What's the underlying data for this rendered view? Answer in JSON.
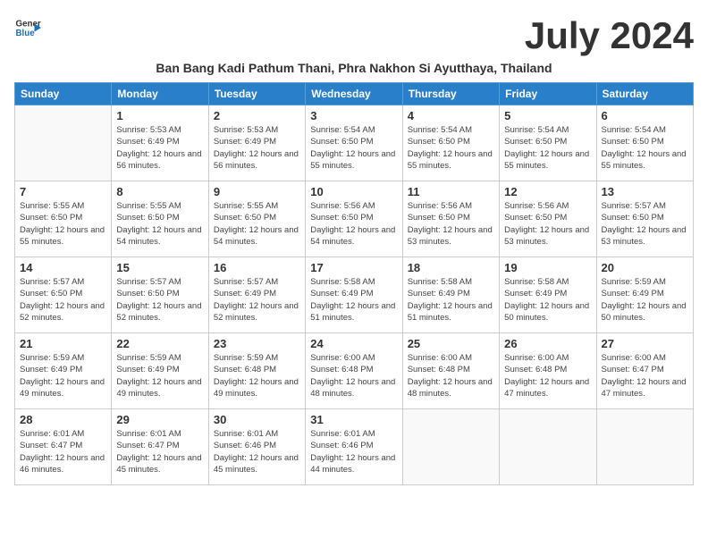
{
  "logo": {
    "text_general": "General",
    "text_blue": "Blue",
    "icon": "▶"
  },
  "month_title": "July 2024",
  "subtitle": "Ban Bang Kadi Pathum Thani, Phra Nakhon Si Ayutthaya, Thailand",
  "headers": [
    "Sunday",
    "Monday",
    "Tuesday",
    "Wednesday",
    "Thursday",
    "Friday",
    "Saturday"
  ],
  "weeks": [
    [
      {
        "day": "",
        "sunrise": "",
        "sunset": "",
        "daylight": ""
      },
      {
        "day": "1",
        "sunrise": "Sunrise: 5:53 AM",
        "sunset": "Sunset: 6:49 PM",
        "daylight": "Daylight: 12 hours and 56 minutes."
      },
      {
        "day": "2",
        "sunrise": "Sunrise: 5:53 AM",
        "sunset": "Sunset: 6:49 PM",
        "daylight": "Daylight: 12 hours and 56 minutes."
      },
      {
        "day": "3",
        "sunrise": "Sunrise: 5:54 AM",
        "sunset": "Sunset: 6:50 PM",
        "daylight": "Daylight: 12 hours and 55 minutes."
      },
      {
        "day": "4",
        "sunrise": "Sunrise: 5:54 AM",
        "sunset": "Sunset: 6:50 PM",
        "daylight": "Daylight: 12 hours and 55 minutes."
      },
      {
        "day": "5",
        "sunrise": "Sunrise: 5:54 AM",
        "sunset": "Sunset: 6:50 PM",
        "daylight": "Daylight: 12 hours and 55 minutes."
      },
      {
        "day": "6",
        "sunrise": "Sunrise: 5:54 AM",
        "sunset": "Sunset: 6:50 PM",
        "daylight": "Daylight: 12 hours and 55 minutes."
      }
    ],
    [
      {
        "day": "7",
        "sunrise": "Sunrise: 5:55 AM",
        "sunset": "Sunset: 6:50 PM",
        "daylight": "Daylight: 12 hours and 55 minutes."
      },
      {
        "day": "8",
        "sunrise": "Sunrise: 5:55 AM",
        "sunset": "Sunset: 6:50 PM",
        "daylight": "Daylight: 12 hours and 54 minutes."
      },
      {
        "day": "9",
        "sunrise": "Sunrise: 5:55 AM",
        "sunset": "Sunset: 6:50 PM",
        "daylight": "Daylight: 12 hours and 54 minutes."
      },
      {
        "day": "10",
        "sunrise": "Sunrise: 5:56 AM",
        "sunset": "Sunset: 6:50 PM",
        "daylight": "Daylight: 12 hours and 54 minutes."
      },
      {
        "day": "11",
        "sunrise": "Sunrise: 5:56 AM",
        "sunset": "Sunset: 6:50 PM",
        "daylight": "Daylight: 12 hours and 53 minutes."
      },
      {
        "day": "12",
        "sunrise": "Sunrise: 5:56 AM",
        "sunset": "Sunset: 6:50 PM",
        "daylight": "Daylight: 12 hours and 53 minutes."
      },
      {
        "day": "13",
        "sunrise": "Sunrise: 5:57 AM",
        "sunset": "Sunset: 6:50 PM",
        "daylight": "Daylight: 12 hours and 53 minutes."
      }
    ],
    [
      {
        "day": "14",
        "sunrise": "Sunrise: 5:57 AM",
        "sunset": "Sunset: 6:50 PM",
        "daylight": "Daylight: 12 hours and 52 minutes."
      },
      {
        "day": "15",
        "sunrise": "Sunrise: 5:57 AM",
        "sunset": "Sunset: 6:50 PM",
        "daylight": "Daylight: 12 hours and 52 minutes."
      },
      {
        "day": "16",
        "sunrise": "Sunrise: 5:57 AM",
        "sunset": "Sunset: 6:49 PM",
        "daylight": "Daylight: 12 hours and 52 minutes."
      },
      {
        "day": "17",
        "sunrise": "Sunrise: 5:58 AM",
        "sunset": "Sunset: 6:49 PM",
        "daylight": "Daylight: 12 hours and 51 minutes."
      },
      {
        "day": "18",
        "sunrise": "Sunrise: 5:58 AM",
        "sunset": "Sunset: 6:49 PM",
        "daylight": "Daylight: 12 hours and 51 minutes."
      },
      {
        "day": "19",
        "sunrise": "Sunrise: 5:58 AM",
        "sunset": "Sunset: 6:49 PM",
        "daylight": "Daylight: 12 hours and 50 minutes."
      },
      {
        "day": "20",
        "sunrise": "Sunrise: 5:59 AM",
        "sunset": "Sunset: 6:49 PM",
        "daylight": "Daylight: 12 hours and 50 minutes."
      }
    ],
    [
      {
        "day": "21",
        "sunrise": "Sunrise: 5:59 AM",
        "sunset": "Sunset: 6:49 PM",
        "daylight": "Daylight: 12 hours and 49 minutes."
      },
      {
        "day": "22",
        "sunrise": "Sunrise: 5:59 AM",
        "sunset": "Sunset: 6:49 PM",
        "daylight": "Daylight: 12 hours and 49 minutes."
      },
      {
        "day": "23",
        "sunrise": "Sunrise: 5:59 AM",
        "sunset": "Sunset: 6:48 PM",
        "daylight": "Daylight: 12 hours and 49 minutes."
      },
      {
        "day": "24",
        "sunrise": "Sunrise: 6:00 AM",
        "sunset": "Sunset: 6:48 PM",
        "daylight": "Daylight: 12 hours and 48 minutes."
      },
      {
        "day": "25",
        "sunrise": "Sunrise: 6:00 AM",
        "sunset": "Sunset: 6:48 PM",
        "daylight": "Daylight: 12 hours and 48 minutes."
      },
      {
        "day": "26",
        "sunrise": "Sunrise: 6:00 AM",
        "sunset": "Sunset: 6:48 PM",
        "daylight": "Daylight: 12 hours and 47 minutes."
      },
      {
        "day": "27",
        "sunrise": "Sunrise: 6:00 AM",
        "sunset": "Sunset: 6:47 PM",
        "daylight": "Daylight: 12 hours and 47 minutes."
      }
    ],
    [
      {
        "day": "28",
        "sunrise": "Sunrise: 6:01 AM",
        "sunset": "Sunset: 6:47 PM",
        "daylight": "Daylight: 12 hours and 46 minutes."
      },
      {
        "day": "29",
        "sunrise": "Sunrise: 6:01 AM",
        "sunset": "Sunset: 6:47 PM",
        "daylight": "Daylight: 12 hours and 45 minutes."
      },
      {
        "day": "30",
        "sunrise": "Sunrise: 6:01 AM",
        "sunset": "Sunset: 6:46 PM",
        "daylight": "Daylight: 12 hours and 45 minutes."
      },
      {
        "day": "31",
        "sunrise": "Sunrise: 6:01 AM",
        "sunset": "Sunset: 6:46 PM",
        "daylight": "Daylight: 12 hours and 44 minutes."
      },
      {
        "day": "",
        "sunrise": "",
        "sunset": "",
        "daylight": ""
      },
      {
        "day": "",
        "sunrise": "",
        "sunset": "",
        "daylight": ""
      },
      {
        "day": "",
        "sunrise": "",
        "sunset": "",
        "daylight": ""
      }
    ]
  ]
}
